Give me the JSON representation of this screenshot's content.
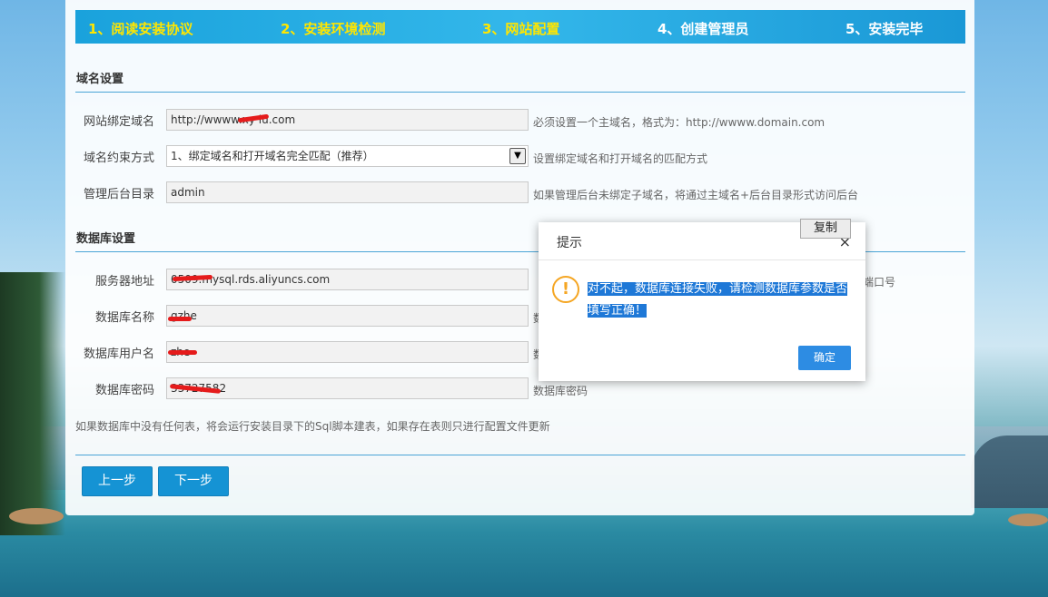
{
  "steps": [
    {
      "label": "1、阅读安装协议",
      "state": "done"
    },
    {
      "label": "2、安装环境检测",
      "state": "done"
    },
    {
      "label": "3、网站配置",
      "state": "done"
    },
    {
      "label": "4、创建管理员",
      "state": "todo"
    },
    {
      "label": "5、安装完毕",
      "state": "todo"
    }
  ],
  "domain_section": {
    "title": "域名设置",
    "bind_domain": {
      "label": "网站绑定域名",
      "value": "http://wwww.xy    iu.com",
      "hint": "必须设置一个主域名，格式为：http://wwww.domain.com"
    },
    "match_mode": {
      "label": "域名约束方式",
      "value": "1、绑定域名和打开域名完全匹配（推荐）",
      "hint": "设置绑定域名和打开域名的匹配方式"
    },
    "admin_dir": {
      "label": "管理后台目录",
      "value": "admin",
      "hint": "如果管理后台未绑定子域名，将通过主域名+后台目录形式访问后台"
    }
  },
  "db_section": {
    "title": "数据库设置",
    "server": {
      "label": "服务器地址",
      "value": "            0509.mysql.rds.aliyuncs.com",
      "hint_partial": "端口号"
    },
    "db_name": {
      "label": "数据库名称",
      "value": "    gzhe",
      "hint_partial": "数"
    },
    "db_user": {
      "label": "数据库用户名",
      "value": "     zhe",
      "hint_partial": "数"
    },
    "db_pass": {
      "label": "数据库密码",
      "value": "       33727582",
      "hint": "数据库密码"
    },
    "note": "如果数据库中没有任何表，将会运行安装目录下的Sql脚本建表，如果存在表则只进行配置文件更新"
  },
  "buttons": {
    "prev": "上一步",
    "next": "下一步"
  },
  "dialog": {
    "title": "提示",
    "copy": "复制",
    "close": "×",
    "icon": "!",
    "message": "对不起，数据库连接失败，请检测数据库参数是否填写正确！",
    "ok": "确定"
  },
  "colors": {
    "step_done": "#ffe600",
    "step_todo": "#ffffff",
    "button": "#1593d4",
    "dialog_ok": "#2d8ce3",
    "selection": "#1e78d7"
  }
}
